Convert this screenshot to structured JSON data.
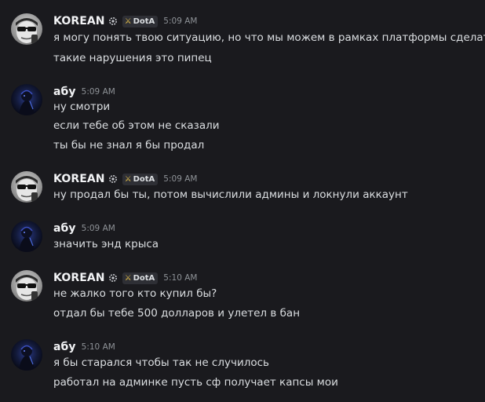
{
  "messages": [
    {
      "author": "KOREAN",
      "tag": "DotA",
      "time": "5:09 AM",
      "avatar": "korean-avatar",
      "lines": [
        "я могу понять твою ситуацию, но что мы можем в рамках платформы сделать?",
        "такие нарушения это пипец"
      ]
    },
    {
      "author": "абу",
      "time": "5:09 AM",
      "avatar": "abu-avatar",
      "lines": [
        "ну смотри",
        "если тебе об этом не сказали",
        "ты бы не знал я бы продал"
      ]
    },
    {
      "author": "KOREAN",
      "tag": "DotA",
      "time": "5:09 AM",
      "avatar": "korean-avatar",
      "lines": [
        "ну продал бы ты, потом вычислили админы и локнули аккаунт"
      ]
    },
    {
      "author": "абу",
      "time": "5:09 AM",
      "avatar": "abu-avatar",
      "lines": [
        "значить энд крыса"
      ]
    },
    {
      "author": "KOREAN",
      "tag": "DotA",
      "time": "5:10 AM",
      "avatar": "korean-avatar",
      "lines": [
        "не жалко того кто купил бы?",
        "отдал бы тебе 500 долларов и улетел в бан"
      ]
    },
    {
      "author": "абу",
      "time": "5:10 AM",
      "avatar": "abu-avatar",
      "lines": [
        "я бы старался чтобы так не случилось",
        "работал на админке пусть сф получает капсы мои"
      ]
    }
  ],
  "colors": {
    "background": "#1a1a1e",
    "username": "#f2f3f5",
    "text": "#dbdee1",
    "timestamp": "#8e9297",
    "tag_background": "#2e2f35",
    "tag_icon": "#e8c24a"
  }
}
